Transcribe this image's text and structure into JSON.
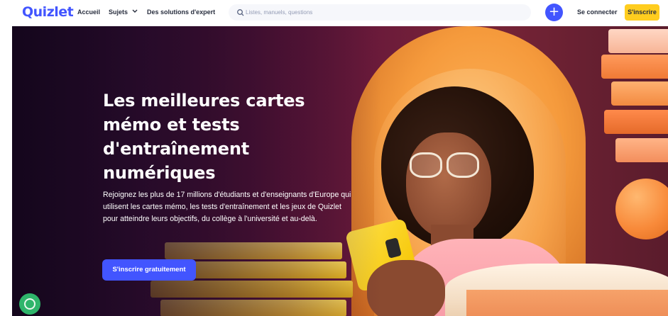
{
  "header": {
    "logo_text": "Quizlet",
    "nav": [
      {
        "label": "Accueil"
      },
      {
        "label": "Sujets",
        "has_dropdown": true
      },
      {
        "label": "Des solutions d'expert"
      }
    ],
    "search": {
      "placeholder": "Listes, manuels, questions",
      "value": ""
    },
    "create_button": {
      "icon": "plus-icon",
      "symbol": "+"
    },
    "login_label": "Se connecter",
    "signup_label": "S'inscrire"
  },
  "hero": {
    "title_lines": [
      "Les meilleures cartes",
      "mémo et tests",
      "d'entraînement",
      "numériques"
    ],
    "description": "Rejoignez les plus de 17 millions d'étudiants et d'enseignants d'Europe qui utilisent les cartes mémo, les tests d'entraînement et les jeux de Quizlet pour atteindre leurs objectifs, du collège à l'université et au-delà.",
    "cta_label": "S'inscrire gratuitement"
  },
  "colors": {
    "brand_blue": "#4255ff",
    "signup_yellow": "#ffcd1f",
    "chat_green": "#2fb56b"
  },
  "chat_widget": {
    "icon": "chat-icon"
  }
}
